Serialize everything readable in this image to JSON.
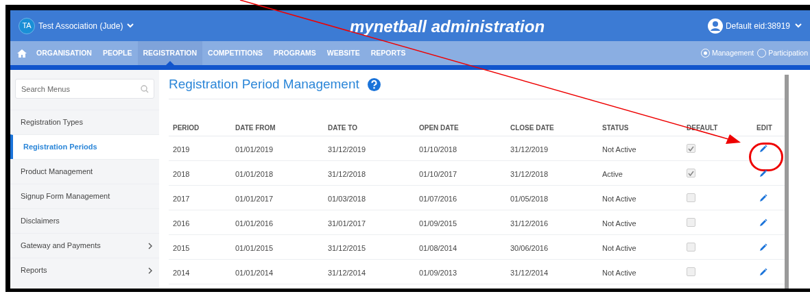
{
  "header": {
    "org_initials": "TA",
    "org_name": "Test Association (Jude)",
    "app_title": "mynetball administration",
    "user": "Default eid:38919"
  },
  "nav": {
    "items": [
      {
        "label": "ORGANISATION",
        "selected": false
      },
      {
        "label": "PEOPLE",
        "selected": false
      },
      {
        "label": "REGISTRATION",
        "selected": true
      },
      {
        "label": "COMPETITIONS",
        "selected": false
      },
      {
        "label": "PROGRAMS",
        "selected": false
      },
      {
        "label": "WEBSITE",
        "selected": false
      },
      {
        "label": "REPORTS",
        "selected": false
      }
    ],
    "modes": [
      {
        "label": "Management",
        "selected": true
      },
      {
        "label": "Participation",
        "selected": false
      }
    ]
  },
  "sidebar": {
    "search": {
      "placeholder": "Search Menus"
    },
    "items": [
      {
        "label": "Registration Types",
        "selected": false,
        "has_submenu": false
      },
      {
        "label": "Registration Periods",
        "selected": true,
        "has_submenu": false
      },
      {
        "label": "Product Management",
        "selected": false,
        "has_submenu": false
      },
      {
        "label": "Signup Form Management",
        "selected": false,
        "has_submenu": false
      },
      {
        "label": "Disclaimers",
        "selected": false,
        "has_submenu": false
      },
      {
        "label": "Gateway and Payments",
        "selected": false,
        "has_submenu": true
      },
      {
        "label": "Reports",
        "selected": false,
        "has_submenu": true
      }
    ]
  },
  "page": {
    "title": "Registration Period Management"
  },
  "table": {
    "columns": [
      "PERIOD",
      "DATE FROM",
      "DATE TO",
      "OPEN DATE",
      "CLOSE DATE",
      "STATUS",
      "DEFAULT",
      "EDIT"
    ],
    "rows": [
      {
        "period": "2019",
        "date_from": "01/01/2019",
        "date_to": "31/12/2019",
        "open_date": "01/10/2018",
        "close_date": "31/12/2019",
        "status": "Not Active",
        "default": true,
        "circled": true
      },
      {
        "period": "2018",
        "date_from": "01/01/2018",
        "date_to": "31/12/2018",
        "open_date": "01/10/2017",
        "close_date": "31/12/2018",
        "status": "Active",
        "default": true,
        "circled": false
      },
      {
        "period": "2017",
        "date_from": "01/01/2017",
        "date_to": "01/03/2018",
        "open_date": "01/07/2016",
        "close_date": "01/05/2018",
        "status": "Not Active",
        "default": false,
        "circled": false
      },
      {
        "period": "2016",
        "date_from": "01/01/2016",
        "date_to": "31/01/2017",
        "open_date": "01/09/2015",
        "close_date": "31/12/2016",
        "status": "Not Active",
        "default": false,
        "circled": false
      },
      {
        "period": "2015",
        "date_from": "01/01/2015",
        "date_to": "31/12/2015",
        "open_date": "01/08/2014",
        "close_date": "30/06/2016",
        "status": "Not Active",
        "default": false,
        "circled": false
      },
      {
        "period": "2014",
        "date_from": "01/01/2014",
        "date_to": "31/12/2014",
        "open_date": "01/09/2013",
        "close_date": "31/12/2014",
        "status": "Not Active",
        "default": false,
        "circled": false
      }
    ]
  }
}
